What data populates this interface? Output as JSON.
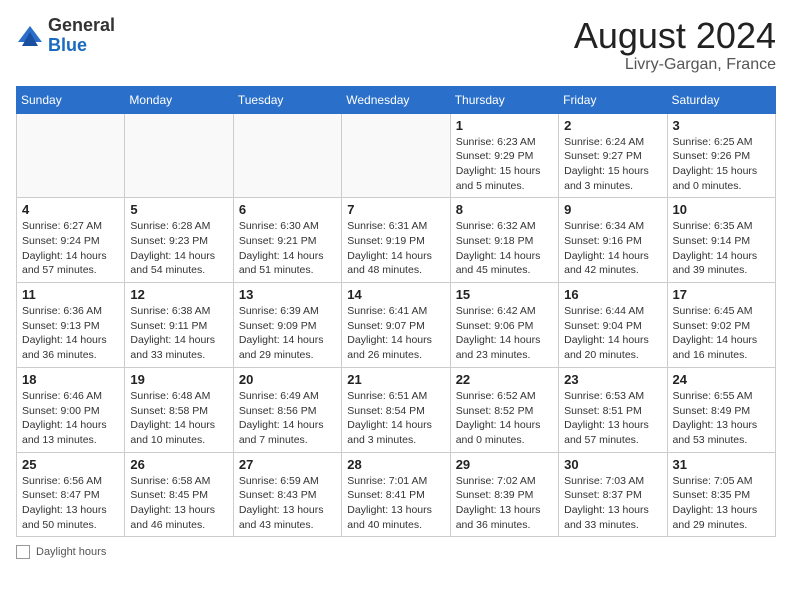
{
  "header": {
    "logo_general": "General",
    "logo_blue": "Blue",
    "month_year": "August 2024",
    "location": "Livry-Gargan, France"
  },
  "footer": {
    "label": "Daylight hours"
  },
  "days_of_week": [
    "Sunday",
    "Monday",
    "Tuesday",
    "Wednesday",
    "Thursday",
    "Friday",
    "Saturday"
  ],
  "weeks": [
    [
      {
        "day": "",
        "sunrise": "",
        "sunset": "",
        "daylight": ""
      },
      {
        "day": "",
        "sunrise": "",
        "sunset": "",
        "daylight": ""
      },
      {
        "day": "",
        "sunrise": "",
        "sunset": "",
        "daylight": ""
      },
      {
        "day": "",
        "sunrise": "",
        "sunset": "",
        "daylight": ""
      },
      {
        "day": "1",
        "sunrise": "Sunrise: 6:23 AM",
        "sunset": "Sunset: 9:29 PM",
        "daylight": "Daylight: 15 hours and 5 minutes."
      },
      {
        "day": "2",
        "sunrise": "Sunrise: 6:24 AM",
        "sunset": "Sunset: 9:27 PM",
        "daylight": "Daylight: 15 hours and 3 minutes."
      },
      {
        "day": "3",
        "sunrise": "Sunrise: 6:25 AM",
        "sunset": "Sunset: 9:26 PM",
        "daylight": "Daylight: 15 hours and 0 minutes."
      }
    ],
    [
      {
        "day": "4",
        "sunrise": "Sunrise: 6:27 AM",
        "sunset": "Sunset: 9:24 PM",
        "daylight": "Daylight: 14 hours and 57 minutes."
      },
      {
        "day": "5",
        "sunrise": "Sunrise: 6:28 AM",
        "sunset": "Sunset: 9:23 PM",
        "daylight": "Daylight: 14 hours and 54 minutes."
      },
      {
        "day": "6",
        "sunrise": "Sunrise: 6:30 AM",
        "sunset": "Sunset: 9:21 PM",
        "daylight": "Daylight: 14 hours and 51 minutes."
      },
      {
        "day": "7",
        "sunrise": "Sunrise: 6:31 AM",
        "sunset": "Sunset: 9:19 PM",
        "daylight": "Daylight: 14 hours and 48 minutes."
      },
      {
        "day": "8",
        "sunrise": "Sunrise: 6:32 AM",
        "sunset": "Sunset: 9:18 PM",
        "daylight": "Daylight: 14 hours and 45 minutes."
      },
      {
        "day": "9",
        "sunrise": "Sunrise: 6:34 AM",
        "sunset": "Sunset: 9:16 PM",
        "daylight": "Daylight: 14 hours and 42 minutes."
      },
      {
        "day": "10",
        "sunrise": "Sunrise: 6:35 AM",
        "sunset": "Sunset: 9:14 PM",
        "daylight": "Daylight: 14 hours and 39 minutes."
      }
    ],
    [
      {
        "day": "11",
        "sunrise": "Sunrise: 6:36 AM",
        "sunset": "Sunset: 9:13 PM",
        "daylight": "Daylight: 14 hours and 36 minutes."
      },
      {
        "day": "12",
        "sunrise": "Sunrise: 6:38 AM",
        "sunset": "Sunset: 9:11 PM",
        "daylight": "Daylight: 14 hours and 33 minutes."
      },
      {
        "day": "13",
        "sunrise": "Sunrise: 6:39 AM",
        "sunset": "Sunset: 9:09 PM",
        "daylight": "Daylight: 14 hours and 29 minutes."
      },
      {
        "day": "14",
        "sunrise": "Sunrise: 6:41 AM",
        "sunset": "Sunset: 9:07 PM",
        "daylight": "Daylight: 14 hours and 26 minutes."
      },
      {
        "day": "15",
        "sunrise": "Sunrise: 6:42 AM",
        "sunset": "Sunset: 9:06 PM",
        "daylight": "Daylight: 14 hours and 23 minutes."
      },
      {
        "day": "16",
        "sunrise": "Sunrise: 6:44 AM",
        "sunset": "Sunset: 9:04 PM",
        "daylight": "Daylight: 14 hours and 20 minutes."
      },
      {
        "day": "17",
        "sunrise": "Sunrise: 6:45 AM",
        "sunset": "Sunset: 9:02 PM",
        "daylight": "Daylight: 14 hours and 16 minutes."
      }
    ],
    [
      {
        "day": "18",
        "sunrise": "Sunrise: 6:46 AM",
        "sunset": "Sunset: 9:00 PM",
        "daylight": "Daylight: 14 hours and 13 minutes."
      },
      {
        "day": "19",
        "sunrise": "Sunrise: 6:48 AM",
        "sunset": "Sunset: 8:58 PM",
        "daylight": "Daylight: 14 hours and 10 minutes."
      },
      {
        "day": "20",
        "sunrise": "Sunrise: 6:49 AM",
        "sunset": "Sunset: 8:56 PM",
        "daylight": "Daylight: 14 hours and 7 minutes."
      },
      {
        "day": "21",
        "sunrise": "Sunrise: 6:51 AM",
        "sunset": "Sunset: 8:54 PM",
        "daylight": "Daylight: 14 hours and 3 minutes."
      },
      {
        "day": "22",
        "sunrise": "Sunrise: 6:52 AM",
        "sunset": "Sunset: 8:52 PM",
        "daylight": "Daylight: 14 hours and 0 minutes."
      },
      {
        "day": "23",
        "sunrise": "Sunrise: 6:53 AM",
        "sunset": "Sunset: 8:51 PM",
        "daylight": "Daylight: 13 hours and 57 minutes."
      },
      {
        "day": "24",
        "sunrise": "Sunrise: 6:55 AM",
        "sunset": "Sunset: 8:49 PM",
        "daylight": "Daylight: 13 hours and 53 minutes."
      }
    ],
    [
      {
        "day": "25",
        "sunrise": "Sunrise: 6:56 AM",
        "sunset": "Sunset: 8:47 PM",
        "daylight": "Daylight: 13 hours and 50 minutes."
      },
      {
        "day": "26",
        "sunrise": "Sunrise: 6:58 AM",
        "sunset": "Sunset: 8:45 PM",
        "daylight": "Daylight: 13 hours and 46 minutes."
      },
      {
        "day": "27",
        "sunrise": "Sunrise: 6:59 AM",
        "sunset": "Sunset: 8:43 PM",
        "daylight": "Daylight: 13 hours and 43 minutes."
      },
      {
        "day": "28",
        "sunrise": "Sunrise: 7:01 AM",
        "sunset": "Sunset: 8:41 PM",
        "daylight": "Daylight: 13 hours and 40 minutes."
      },
      {
        "day": "29",
        "sunrise": "Sunrise: 7:02 AM",
        "sunset": "Sunset: 8:39 PM",
        "daylight": "Daylight: 13 hours and 36 minutes."
      },
      {
        "day": "30",
        "sunrise": "Sunrise: 7:03 AM",
        "sunset": "Sunset: 8:37 PM",
        "daylight": "Daylight: 13 hours and 33 minutes."
      },
      {
        "day": "31",
        "sunrise": "Sunrise: 7:05 AM",
        "sunset": "Sunset: 8:35 PM",
        "daylight": "Daylight: 13 hours and 29 minutes."
      }
    ]
  ]
}
